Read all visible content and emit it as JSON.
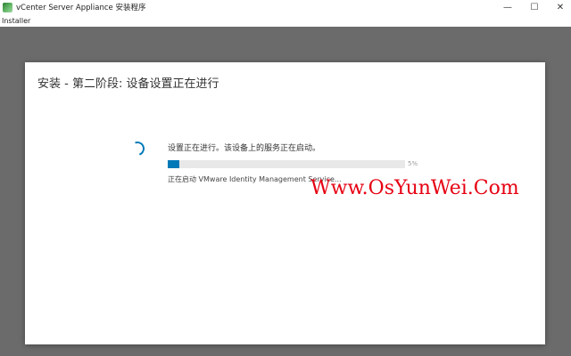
{
  "window": {
    "title": "vCenter Server Appliance 安装程序",
    "controls": {
      "minimize": "—",
      "maximize": "☐",
      "close": "✕"
    }
  },
  "menu": {
    "installer": "Installer"
  },
  "dialog": {
    "title": "安装 - 第二阶段: 设备设置正在进行",
    "status": "设置正在进行。该设备上的服务正在启动。",
    "progress": {
      "percent": 5,
      "label": "5%"
    },
    "current_step": "正在启动 VMware Identity Management Service..."
  },
  "watermark": "Www.OsYunWei.Com",
  "colors": {
    "accent": "#0079b8",
    "backdrop": "#6b6b6b",
    "watermark": "#e60012"
  },
  "icons": {
    "app": "vcenter-app-icon",
    "spinner": "loading-spinner-icon"
  }
}
